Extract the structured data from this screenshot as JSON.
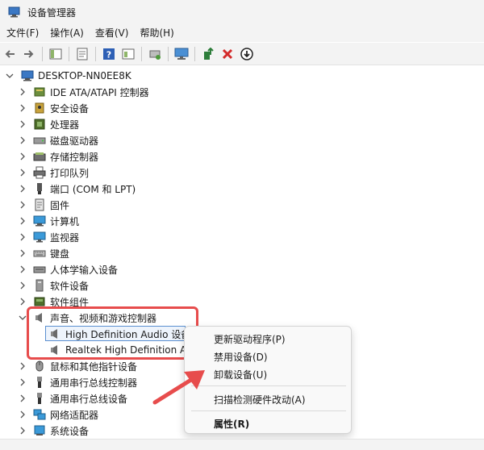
{
  "window": {
    "title": "设备管理器"
  },
  "menu": {
    "items": [
      "文件(F)",
      "操作(A)",
      "查看(V)",
      "帮助(H)"
    ]
  },
  "toolbar": {
    "buttons": [
      "back-icon",
      "forward-icon",
      "properties-icon",
      "help-icon",
      "update-driver-icon",
      "scan-icon",
      "monitor-icon",
      "enable-icon",
      "uninstall-icon",
      "disable-icon"
    ]
  },
  "tree": {
    "root": "DESKTOP-NN0EE8K",
    "nodes": [
      "IDE ATA/ATAPI 控制器",
      "安全设备",
      "处理器",
      "磁盘驱动器",
      "存储控制器",
      "打印队列",
      "端口 (COM 和 LPT)",
      "固件",
      "计算机",
      "监视器",
      "键盘",
      "人体学输入设备",
      "软件设备",
      "软件组件",
      "声音、视频和游戏控制器",
      "High Definition Audio 设备",
      "Realtek High Definition A",
      "鼠标和其他指针设备",
      "通用串行总线控制器",
      "通用串行总线设备",
      "网络适配器",
      "系统设备"
    ]
  },
  "context_menu": {
    "items": [
      "更新驱动程序(P)",
      "禁用设备(D)",
      "卸载设备(U)",
      "扫描检测硬件改动(A)",
      "属性(R)"
    ]
  },
  "colors": {
    "highlight_frame": "#e74c4c",
    "selection": "#5a8fd0"
  }
}
